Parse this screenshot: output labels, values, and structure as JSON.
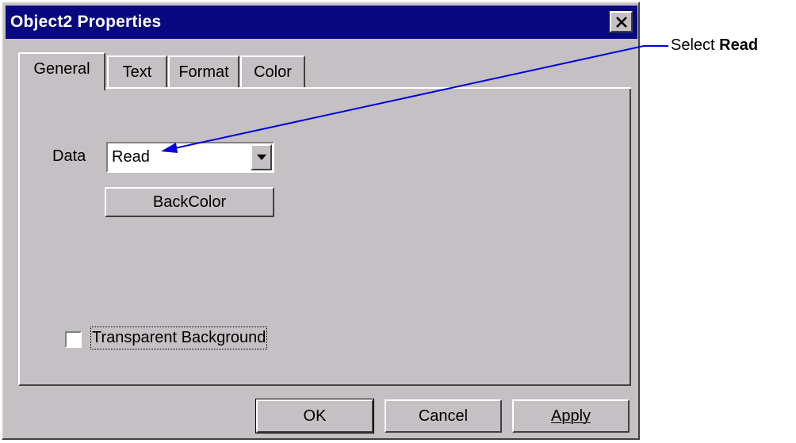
{
  "window": {
    "title": "Object2 Properties"
  },
  "tabs": [
    {
      "label": "General",
      "active": true
    },
    {
      "label": "Text",
      "active": false
    },
    {
      "label": "Format",
      "active": false
    },
    {
      "label": "Color",
      "active": false
    }
  ],
  "general": {
    "data_label": "Data",
    "data_value": "Read",
    "backcolor_label": "BackColor",
    "transparent_label": "Transparent Background",
    "transparent_checked": false
  },
  "buttons": {
    "ok": "OK",
    "cancel": "Cancel",
    "apply": "Apply"
  },
  "annotation": {
    "prefix": "Select ",
    "emphasis": "Read"
  },
  "colors": {
    "title_bar": "#080880",
    "face": "#c4c0c4",
    "annotation_arrow": "#0000dd"
  },
  "icons": {
    "close": "close-icon",
    "dropdown": "chevron-down-icon"
  }
}
